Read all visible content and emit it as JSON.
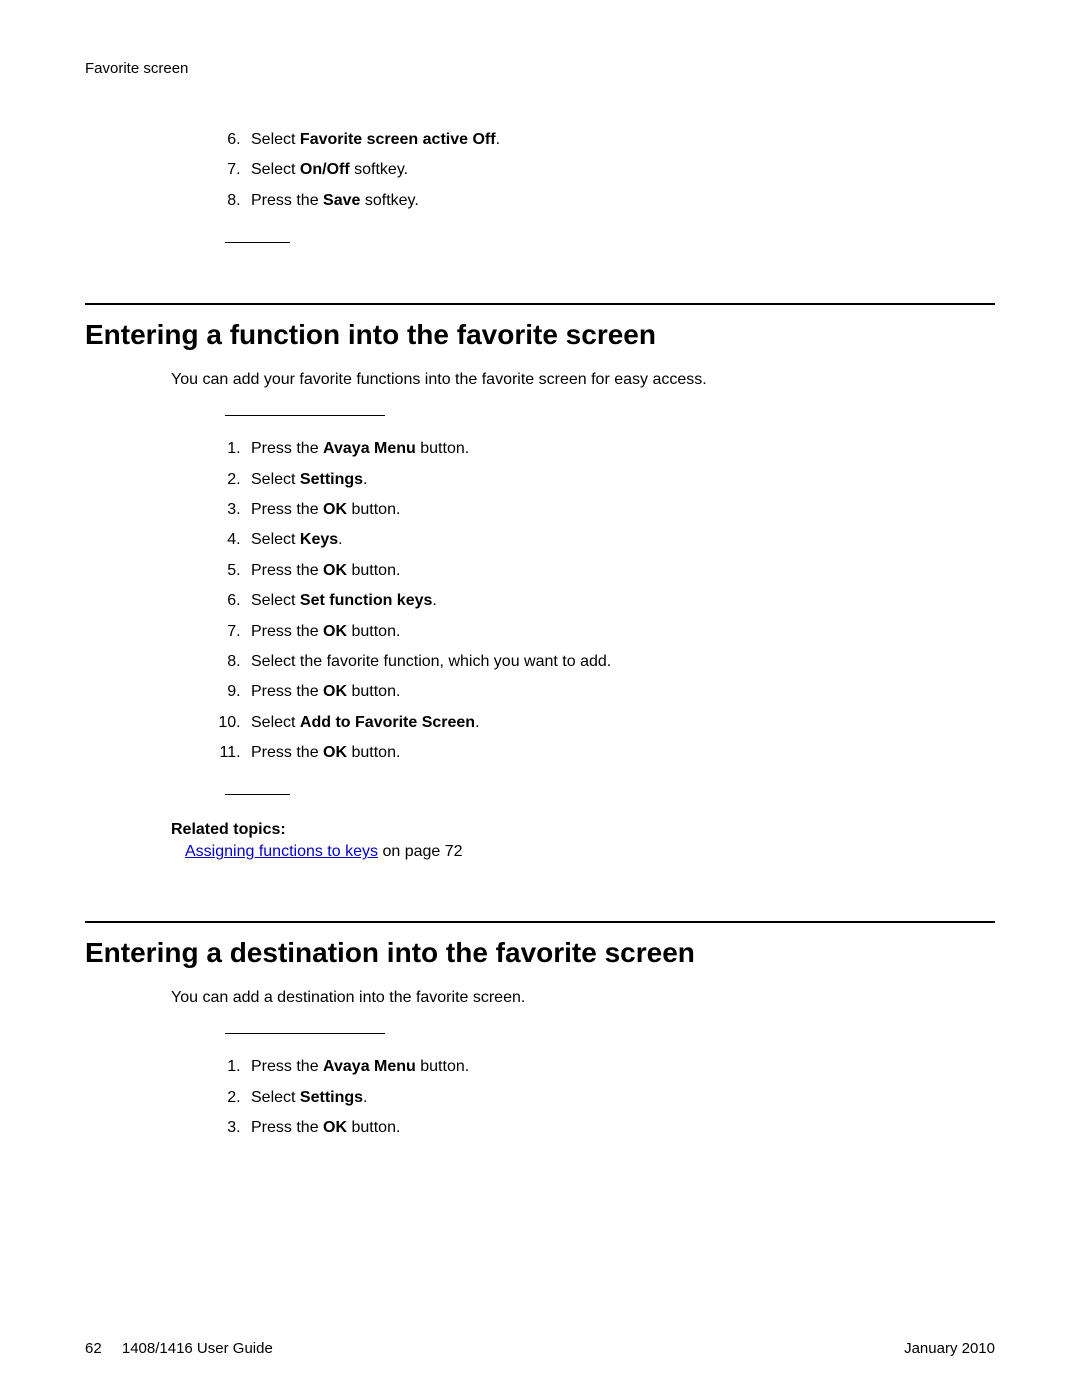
{
  "running_head": "Favorite screen",
  "top_steps": {
    "start": 6,
    "s6": {
      "a": "Select ",
      "b": "Favorite screen active Off",
      "c": "."
    },
    "s7": {
      "a": "Select ",
      "b": "On/Off",
      "c": " softkey."
    },
    "s8": {
      "a": "Press the ",
      "b": "Save",
      "c": " softkey."
    }
  },
  "sec1": {
    "title": "Entering a function into the favorite screen",
    "intro": "You can add your favorite functions into the favorite screen for easy access.",
    "steps": {
      "s1": {
        "a": "Press the ",
        "b": "Avaya Menu",
        "c": " button."
      },
      "s2": {
        "a": "Select ",
        "b": "Settings",
        "c": "."
      },
      "s3": {
        "a": "Press the ",
        "b": "OK",
        "c": " button."
      },
      "s4": {
        "a": "Select ",
        "b": "Keys",
        "c": "."
      },
      "s5": {
        "a": "Press the ",
        "b": "OK",
        "c": " button."
      },
      "s6": {
        "a": "Select ",
        "b": "Set function keys",
        "c": "."
      },
      "s7": {
        "a": "Press the ",
        "b": "OK",
        "c": " button."
      },
      "s8": {
        "a": "Select the favorite function, which you want to add.",
        "b": "",
        "c": ""
      },
      "s9": {
        "a": "Press the ",
        "b": "OK",
        "c": " button."
      },
      "s10": {
        "a": "Select ",
        "b": "Add to Favorite Screen",
        "c": "."
      },
      "s11": {
        "a": "Press the ",
        "b": "OK",
        "c": " button."
      }
    },
    "related_h": "Related topics:",
    "related_link": "Assigning functions to keys",
    "related_tail": " on page 72"
  },
  "sec2": {
    "title": "Entering a destination into the favorite screen",
    "intro": "You can add a destination into the favorite screen.",
    "steps": {
      "s1": {
        "a": "Press the ",
        "b": "Avaya Menu",
        "c": " button."
      },
      "s2": {
        "a": "Select ",
        "b": "Settings",
        "c": "."
      },
      "s3": {
        "a": "Press the ",
        "b": "OK",
        "c": " button."
      }
    }
  },
  "footer": {
    "page": "62",
    "guide": "1408/1416 User Guide",
    "date": "January 2010"
  }
}
